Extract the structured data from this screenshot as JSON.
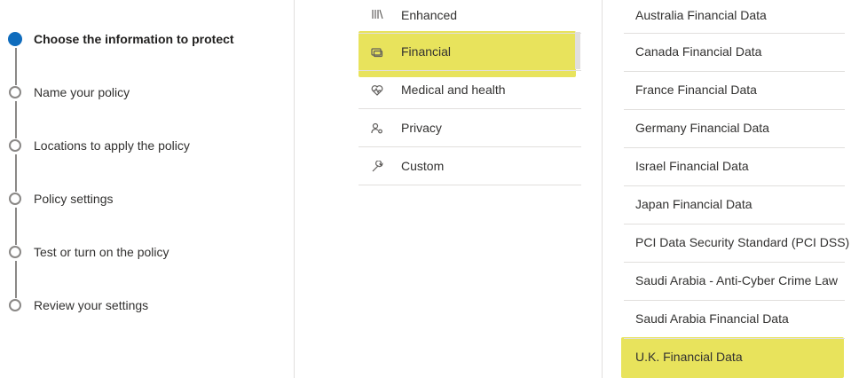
{
  "wizard": {
    "steps": [
      {
        "label": "Choose the information to protect",
        "active": true
      },
      {
        "label": "Name your policy",
        "active": false
      },
      {
        "label": "Locations to apply the policy",
        "active": false
      },
      {
        "label": "Policy settings",
        "active": false
      },
      {
        "label": "Test or turn on the policy",
        "active": false
      },
      {
        "label": "Review your settings",
        "active": false
      }
    ]
  },
  "categories": {
    "items": [
      {
        "label": "Enhanced",
        "icon": "books-icon"
      },
      {
        "label": "Financial",
        "icon": "credit-card-icon",
        "selected": true
      },
      {
        "label": "Medical and health",
        "icon": "heart-pulse-icon"
      },
      {
        "label": "Privacy",
        "icon": "person-key-icon"
      },
      {
        "label": "Custom",
        "icon": "wrench-icon"
      }
    ]
  },
  "templates": {
    "items": [
      {
        "label": "Australia Financial Data"
      },
      {
        "label": "Canada Financial Data"
      },
      {
        "label": "France Financial Data"
      },
      {
        "label": "Germany Financial Data"
      },
      {
        "label": "Israel Financial Data"
      },
      {
        "label": "Japan Financial Data"
      },
      {
        "label": "PCI Data Security Standard (PCI DSS)"
      },
      {
        "label": "Saudi Arabia - Anti-Cyber Crime Law"
      },
      {
        "label": "Saudi Arabia Financial Data"
      },
      {
        "label": "U.K. Financial Data"
      }
    ]
  },
  "colors": {
    "active_step": "#0f6cbd",
    "highlight": "#e8e35c",
    "divider": "#e1dfdd"
  }
}
